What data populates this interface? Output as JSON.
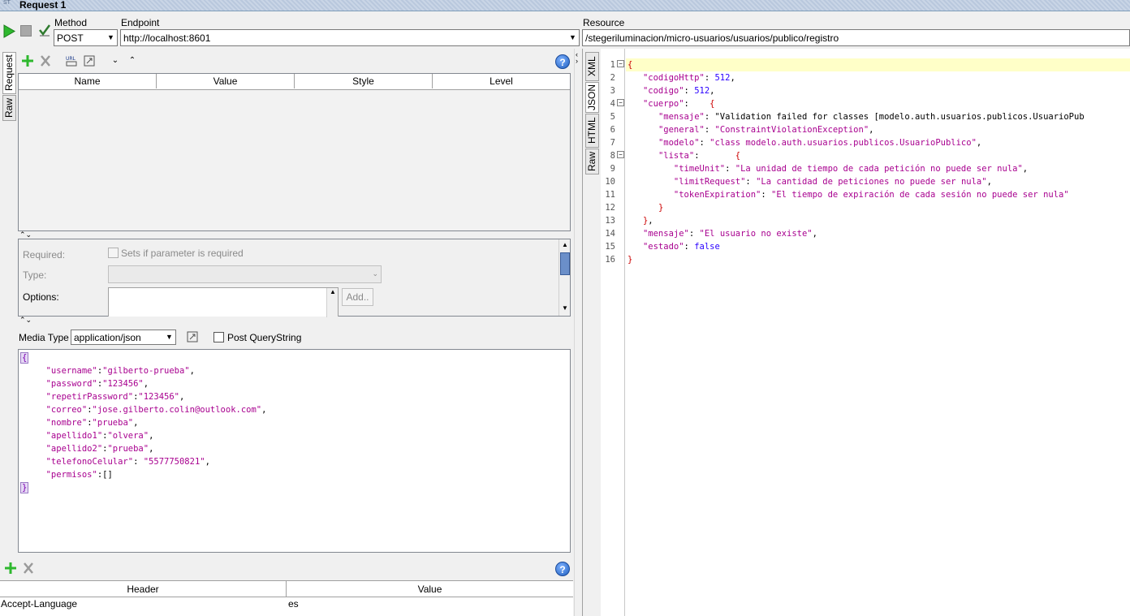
{
  "window": {
    "title": "Request 1",
    "logo_text": "ST"
  },
  "toolbar": {
    "method_label": "Method",
    "method_value": "POST",
    "endpoint_label": "Endpoint",
    "endpoint_value": "http://localhost:8601",
    "resource_label": "Resource",
    "resource_value": "/stegeriluminacion/micro-usuarios/usuarios/publico/registro"
  },
  "request_tabs": [
    "Request",
    "Raw"
  ],
  "response_tabs": [
    "XML",
    "JSON",
    "HTML",
    "Raw"
  ],
  "params": {
    "columns": [
      "Name",
      "Value",
      "Style",
      "Level"
    ],
    "required_label": "Required:",
    "required_checkbox": "Sets if parameter is required",
    "type_label": "Type:",
    "options_label": "Options:",
    "add_button": "Add.."
  },
  "body": {
    "media_type_label": "Media Type",
    "media_type_value": "application/json",
    "post_querystring_label": "Post QueryString",
    "lines": [
      "{",
      "     \"username\":\"gilberto-prueba\",",
      "     \"password\":\"123456\",",
      "     \"repetirPassword\":\"123456\",",
      "     \"correo\":\"jose.gilberto.colin@outlook.com\",",
      "     \"nombre\":\"prueba\",",
      "     \"apellido1\":\"olvera\",",
      "     \"apellido2\":\"prueba\",",
      "     \"telefonoCelular\": \"5577750821\",",
      "     \"permisos\":[]",
      "}"
    ]
  },
  "headers": {
    "columns": [
      "Header",
      "Value"
    ],
    "rows": [
      {
        "header": "Accept-Language",
        "value": "es"
      }
    ]
  },
  "response": {
    "line_numbers": [
      "1",
      "2",
      "3",
      "4",
      "5",
      "6",
      "7",
      "8",
      "9",
      "10",
      "11",
      "12",
      "13",
      "14",
      "15",
      "16"
    ],
    "lines": [
      "{",
      "   \"codigoHttp\": 512,",
      "   \"codigo\": 512,",
      "   \"cuerpo\":    {",
      "      \"mensaje\": \"Validation failed for classes [modelo.auth.usuarios.publicos.UsuarioPub",
      "      \"general\": \"ConstraintViolationException\",",
      "      \"modelo\": \"class modelo.auth.usuarios.publicos.UsuarioPublico\",",
      "      \"lista\":       {",
      "         \"timeUnit\": \"La unidad de tiempo de cada petición no puede ser nula\",",
      "         \"limitRequest\": \"La cantidad de peticiones no puede ser nula\",",
      "         \"tokenExpiration\": \"El tiempo de expiración de cada sesión no puede ser nula\"",
      "      }",
      "   },",
      "   \"mensaje\": \"El usuario no existe\",",
      "   \"estado\": false",
      "}"
    ]
  },
  "colors": {
    "key": "#a8008f",
    "number": "#2a00ff",
    "brace": "#cc0000",
    "highlight": "#ffffc8"
  }
}
